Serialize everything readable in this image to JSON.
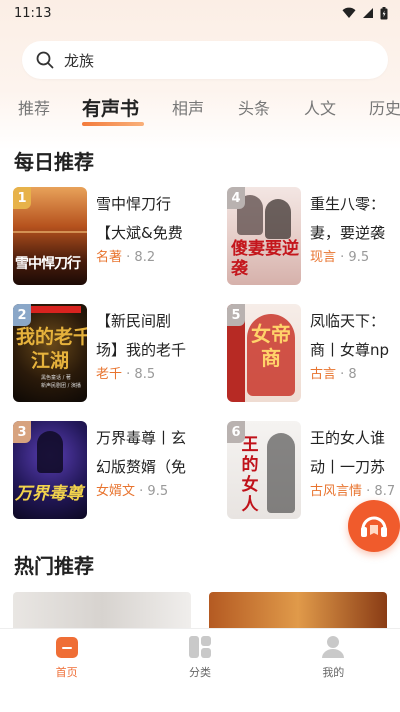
{
  "status_bar": {
    "time": "11:13"
  },
  "search": {
    "query": "龙族",
    "icon": "search-icon"
  },
  "tabs": [
    {
      "label": "推荐",
      "active": false
    },
    {
      "label": "有声书",
      "active": true
    },
    {
      "label": "相声",
      "active": false
    },
    {
      "label": "头条",
      "active": false
    },
    {
      "label": "人文",
      "active": false
    },
    {
      "label": "历史",
      "active": false
    }
  ],
  "daily": {
    "title": "每日推荐",
    "books": [
      {
        "rank": "1",
        "title_line1": "雪中悍刀行",
        "title_line2": "【大斌&免费",
        "category": "名著",
        "score": "8.2"
      },
      {
        "rank": "2",
        "title_line1": "【新民间剧",
        "title_line2": "场】我的老千",
        "category": "老千",
        "score": "8.5"
      },
      {
        "rank": "3",
        "title_line1": "万界毒尊丨玄",
        "title_line2": "幻版赘婿（免",
        "category": "女婿文",
        "score": "9.5"
      },
      {
        "rank": "4",
        "title_line1": "重生八零：",
        "title_line2": "妻，要逆袭",
        "category": "现言",
        "score": "9.5"
      },
      {
        "rank": "5",
        "title_line1": "凤临天下：",
        "title_line2": "商丨女尊np",
        "category": "古言",
        "score": "8"
      },
      {
        "rank": "6",
        "title_line1": "王的女人谁",
        "title_line2": "动丨一刀苏",
        "category": "古风言情",
        "score": "8.7"
      }
    ],
    "cover_text": {
      "c1": "雪中悍刀行",
      "c2_top": "我的老千",
      "c2_bottom": "江湖",
      "c2_small": "黑色童话 / 著\n新声民剧团 / 演播",
      "c3": "万界毒尊",
      "c4": "傻妻要逆袭",
      "c5": "女帝商",
      "c6": "王的女人"
    }
  },
  "hot": {
    "title": "热门推荐"
  },
  "bottom_nav": [
    {
      "label": "首页",
      "icon": "home-icon",
      "active": true
    },
    {
      "label": "分类",
      "icon": "category-icon",
      "active": false
    },
    {
      "label": "我的",
      "icon": "profile-icon",
      "active": false
    }
  ],
  "colors": {
    "accent": "#ef6e36",
    "float_button": "#f05b2c"
  }
}
